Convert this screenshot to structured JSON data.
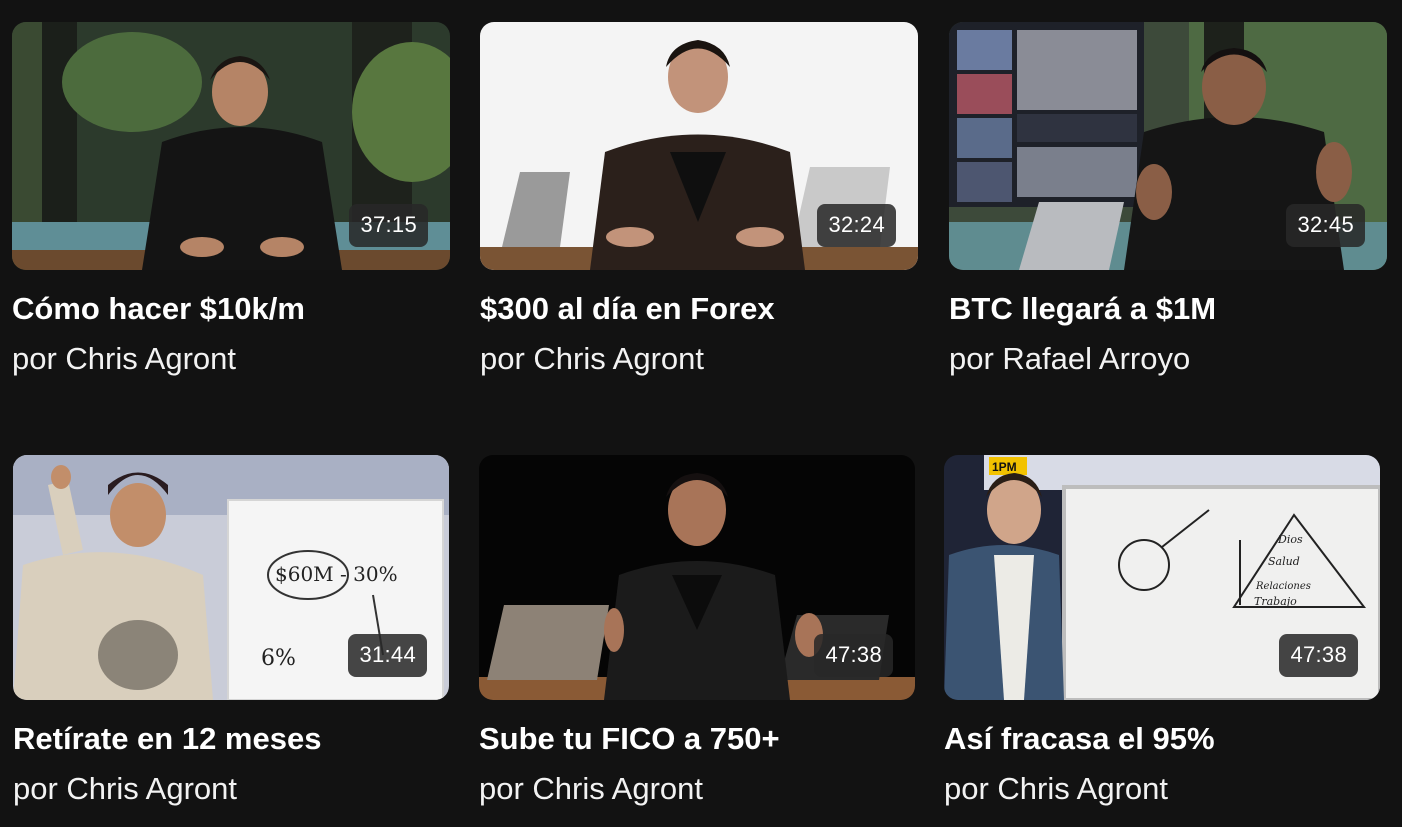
{
  "videos": [
    {
      "title": "Cómo hacer $10k/m",
      "author": "por Chris Agront",
      "duration": "37:15"
    },
    {
      "title": "$300 al día en Forex",
      "author": "por Chris Agront",
      "duration": "32:24"
    },
    {
      "title": "BTC llegará a $1M",
      "author": "por Rafael Arroyo",
      "duration": "32:45"
    },
    {
      "title": "Retírate en 12 meses",
      "author": "por Chris Agront",
      "duration": "31:44"
    },
    {
      "title": "Sube tu FICO a 750+",
      "author": "por Chris Agront",
      "duration": "47:38"
    },
    {
      "title": "Así fracasa el 95%",
      "author": "por Chris Agront",
      "duration": "47:38"
    }
  ],
  "thumbnail_text": {
    "whiteboard_money": "$60M - 30%",
    "whiteboard_money_low": "6%",
    "pyramid_levels": [
      "Dios",
      "Salud",
      "Relaciones",
      "Trabajo"
    ],
    "schedule_header": "1PM"
  }
}
